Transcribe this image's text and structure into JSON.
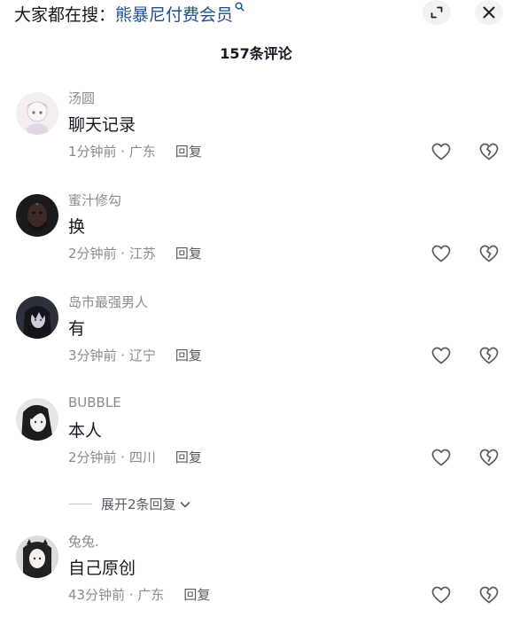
{
  "header": {
    "search_prefix": "大家都在搜：",
    "search_term": "熊暴尼付费会员",
    "comment_count": "157条评论"
  },
  "comments": [
    {
      "username": "汤圆",
      "text": "聊天记录",
      "time": "1分钟前 · 广东",
      "reply": "回复"
    },
    {
      "username": "蜜汁修勾",
      "text": "换",
      "time": "2分钟前 · 江苏",
      "reply": "回复"
    },
    {
      "username": "岛市最强男人",
      "text": "有",
      "time": "3分钟前 · 辽宁",
      "reply": "回复"
    },
    {
      "username": "BUBBLE",
      "text": "本人",
      "time": "2分钟前 · 四川",
      "reply": "回复"
    },
    {
      "username": "兔兔.",
      "text": "自己原创",
      "time": "43分钟前 · 广东",
      "reply": "回复"
    }
  ],
  "expand_replies": "展开2条回复",
  "icons": {
    "search": "search-icon",
    "expand": "expand-icon",
    "close": "close-icon",
    "like": "heart-outline-icon",
    "dislike": "broken-heart-icon",
    "chevron": "chevron-down-icon"
  },
  "colors": {
    "search_term": "#1f4f8f",
    "meta_text": "#8a8b91",
    "primary_text": "#161823"
  }
}
